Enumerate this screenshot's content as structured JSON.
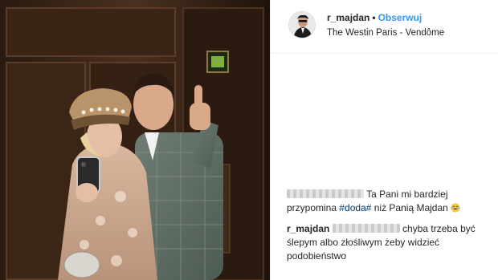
{
  "post": {
    "username": "r_majdan",
    "separator": "•",
    "follow_label": "Obserwuj",
    "location": "The Westin Paris - Vendôme"
  },
  "comments": [
    {
      "user_redacted": true,
      "text_before": "Ta Pani mi bardziej przypomina ",
      "hashtag": "#doda#",
      "text_after": " niż Panią Majdan ",
      "emoji": "laughing-crying-emoji"
    },
    {
      "username": "r_majdan",
      "mention_redacted": true,
      "text": "chyba trzeba być ślepym albo złośliwym żeby widzieć podobieństwo"
    }
  ],
  "colors": {
    "follow_blue": "#3897f0",
    "hashtag": "#003569",
    "text": "#262626",
    "divider": "#efefef"
  }
}
